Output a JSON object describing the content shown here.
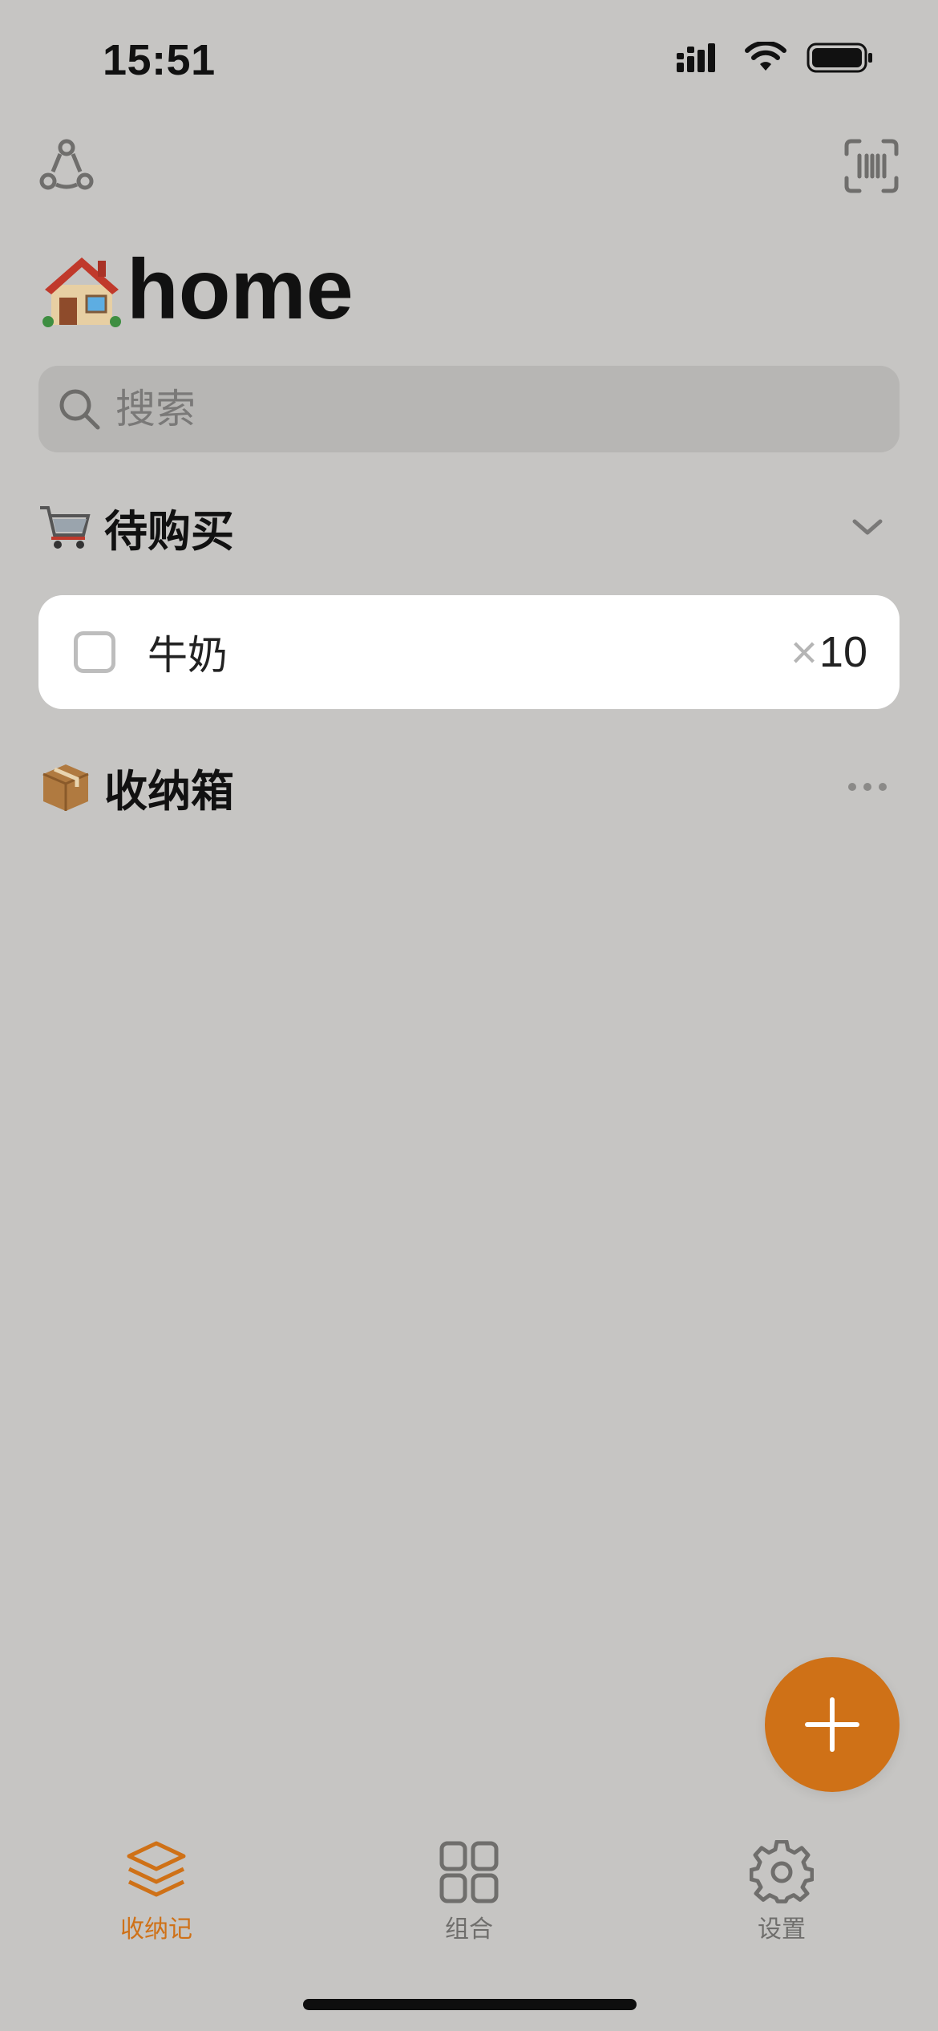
{
  "status_bar": {
    "time": "15:51"
  },
  "header": {
    "title": "home",
    "title_emoji": "house"
  },
  "search": {
    "placeholder": "搜索"
  },
  "sections": {
    "to_buy": {
      "emoji": "shopping-cart",
      "label": "待购买"
    },
    "storage": {
      "emoji": "package",
      "label": "收纳箱"
    }
  },
  "shopping_items": [
    {
      "name": "牛奶",
      "times_symbol": "×",
      "quantity": "10",
      "checked": false
    }
  ],
  "tabbar": {
    "items": [
      {
        "label": "收纳记",
        "icon": "layers-icon",
        "active": true
      },
      {
        "label": "组合",
        "icon": "grid-icon",
        "active": false
      },
      {
        "label": "设置",
        "icon": "gear-icon",
        "active": false
      }
    ]
  },
  "colors": {
    "accent": "#cf7117",
    "background": "#c6c5c3",
    "inactive": "#6f6e6c"
  }
}
